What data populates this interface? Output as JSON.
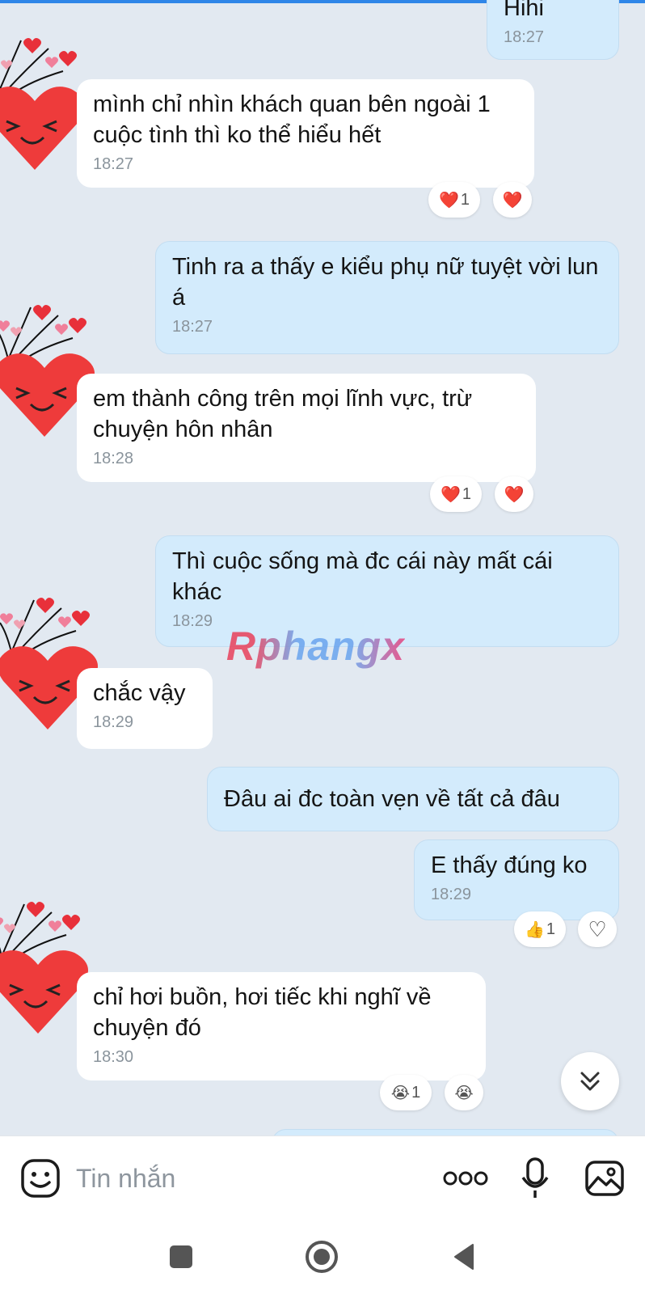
{
  "messages": [
    {
      "id": "m0",
      "direction": "out",
      "text": "Hihi",
      "time": "18:27"
    },
    {
      "id": "m1",
      "direction": "in",
      "text": "mình chỉ nhìn khách quan bên ngoài 1 cuộc tình thì ko thể hiểu hết",
      "time": "18:27",
      "reactions": [
        {
          "emoji": "❤️",
          "count": "1"
        },
        {
          "emoji": "❤️",
          "count": ""
        }
      ]
    },
    {
      "id": "m2",
      "direction": "out",
      "text": "Tinh ra a thấy e kiểu phụ nữ tuyệt vời lun á",
      "time": "18:27"
    },
    {
      "id": "m3",
      "direction": "in",
      "text": "em thành công trên mọi lĩnh vực, trừ chuyện hôn  nhân",
      "time": "18:28",
      "reactions": [
        {
          "emoji": "❤️",
          "count": "1"
        },
        {
          "emoji": "❤️",
          "count": ""
        }
      ]
    },
    {
      "id": "m4",
      "direction": "out",
      "text": "Thì cuộc sống mà đc cái này mất cái khác",
      "time": "18:29"
    },
    {
      "id": "m5",
      "direction": "in",
      "text": "chắc vậy",
      "time": "18:29"
    },
    {
      "id": "m6",
      "direction": "out",
      "text": "Đâu ai đc toàn vẹn về tất cả đâu",
      "time": ""
    },
    {
      "id": "m7",
      "direction": "out",
      "text": "E thấy đúng ko",
      "time": "18:29",
      "reactions": [
        {
          "emoji": "👍",
          "count": "1"
        },
        {
          "emoji": "♡",
          "count": ""
        }
      ]
    },
    {
      "id": "m8",
      "direction": "in",
      "text": "chỉ hơi buồn, hơi tiếc khi nghĩ về chuyện đó",
      "time": "18:30",
      "reactions": [
        {
          "emoji": "😭",
          "count": "1"
        },
        {
          "emoji": "😭",
          "count": ""
        }
      ]
    }
  ],
  "watermark": "Rphangx",
  "composer": {
    "placeholder": "Tin nhắn"
  },
  "icons": {
    "avatar": "heart-face-sticker",
    "emoji": "smiley-icon",
    "more": "more-dots-icon",
    "mic": "microphone-icon",
    "image": "image-icon",
    "scroll": "chevron-double-down-icon"
  },
  "colors": {
    "background": "#e2e9f1",
    "incoming": "#ffffff",
    "outgoing": "#d3ebfc",
    "accent": "#2f86e8"
  }
}
